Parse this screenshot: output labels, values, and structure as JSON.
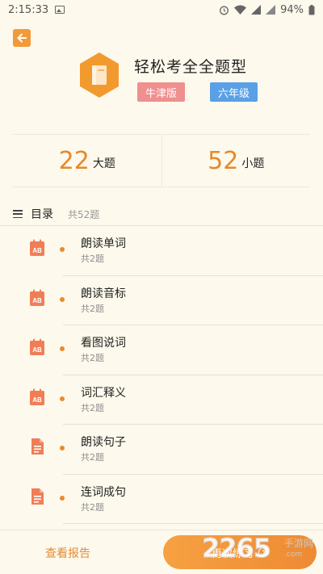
{
  "status_bar": {
    "time": "2:15:33",
    "battery": "94%"
  },
  "header": {
    "title": "轻松考全全题型",
    "edition_tag": "牛津版",
    "grade_tag": "六年级"
  },
  "stats": {
    "big_count": "22",
    "big_unit": "大题",
    "small_count": "52",
    "small_unit": "小题"
  },
  "catalog": {
    "title": "目录",
    "total": "共52题",
    "items": [
      {
        "name": "朗读单词",
        "count": "共2题",
        "icon": "ab-calendar-icon"
      },
      {
        "name": "朗读音标",
        "count": "共2题",
        "icon": "ab-calendar-icon"
      },
      {
        "name": "看图说词",
        "count": "共2题",
        "icon": "ab-calendar-icon"
      },
      {
        "name": "词汇释义",
        "count": "共2题",
        "icon": "ab-calendar-icon"
      },
      {
        "name": "朗读句子",
        "count": "共2题",
        "icon": "document-icon"
      },
      {
        "name": "连词成句",
        "count": "共2题",
        "icon": "document-icon"
      }
    ]
  },
  "bottom_bar": {
    "report_label": "查看报告",
    "retry_label": "再次练习"
  },
  "watermark": {
    "number": "2265",
    "text": "手游网",
    "url": ".com"
  },
  "colors": {
    "accent": "#ee8a33",
    "background": "#fdf9ec",
    "edition_tag": "#ef8f8e",
    "grade_tag": "#5aa0e6"
  }
}
